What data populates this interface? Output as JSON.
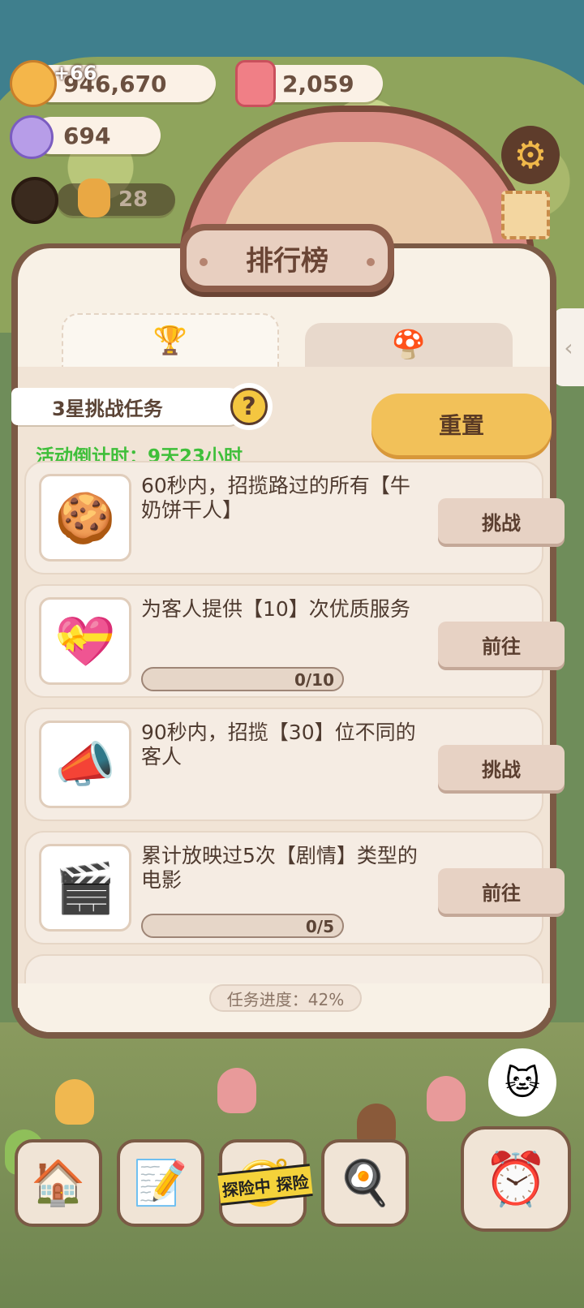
{
  "hud": {
    "coins_value": "946,670",
    "coins_gain": "+66",
    "candles_value": "2,059",
    "gems_value": "694",
    "level_value": "28"
  },
  "panel": {
    "title": "排行榜",
    "tabs": [
      {
        "icon": "trophy-icon",
        "glyph": "🏆",
        "active": true
      },
      {
        "icon": "mushroom-icon",
        "glyph": "🍄",
        "active": false
      }
    ],
    "challenge_label": "3星挑战任务",
    "help_glyph": "?",
    "countdown": "活动倒计时：9天23小时",
    "reset_label": "重置",
    "tasks": [
      {
        "text": "60秒内，招揽路过的所有【牛奶饼干人】",
        "button": "挑战",
        "thumb": "🍪",
        "progress": null
      },
      {
        "text": "为客人提供【10】次优质服务",
        "button": "前往",
        "thumb": "💝",
        "progress": {
          "label": "0/10",
          "fraction": 0.0
        }
      },
      {
        "text": "90秒内，招揽【30】位不同的客人",
        "button": "挑战",
        "thumb": "📣",
        "progress": null
      },
      {
        "text": "累计放映过5次【剧情】类型的电影",
        "button": "前往",
        "thumb": "🎬",
        "progress": {
          "label": "0/5",
          "fraction": 0.0
        }
      }
    ],
    "total_progress": "任务进度：42%"
  },
  "nav": {
    "tape_text": "探险中 探险",
    "buttons": [
      {
        "name": "mushroom-house-icon",
        "glyph": "🏠"
      },
      {
        "name": "notebook-icon",
        "glyph": "📝"
      },
      {
        "name": "adventure-icon",
        "glyph": "🧭"
      },
      {
        "name": "kitchen-icon",
        "glyph": "🍳"
      }
    ],
    "big_button_glyph": "⏰",
    "bubble_glyph": "🐱"
  },
  "colors": {
    "accent_yellow": "#f2c159",
    "countdown_green": "#3fbf3a",
    "panel_brown": "#7b5a45"
  }
}
